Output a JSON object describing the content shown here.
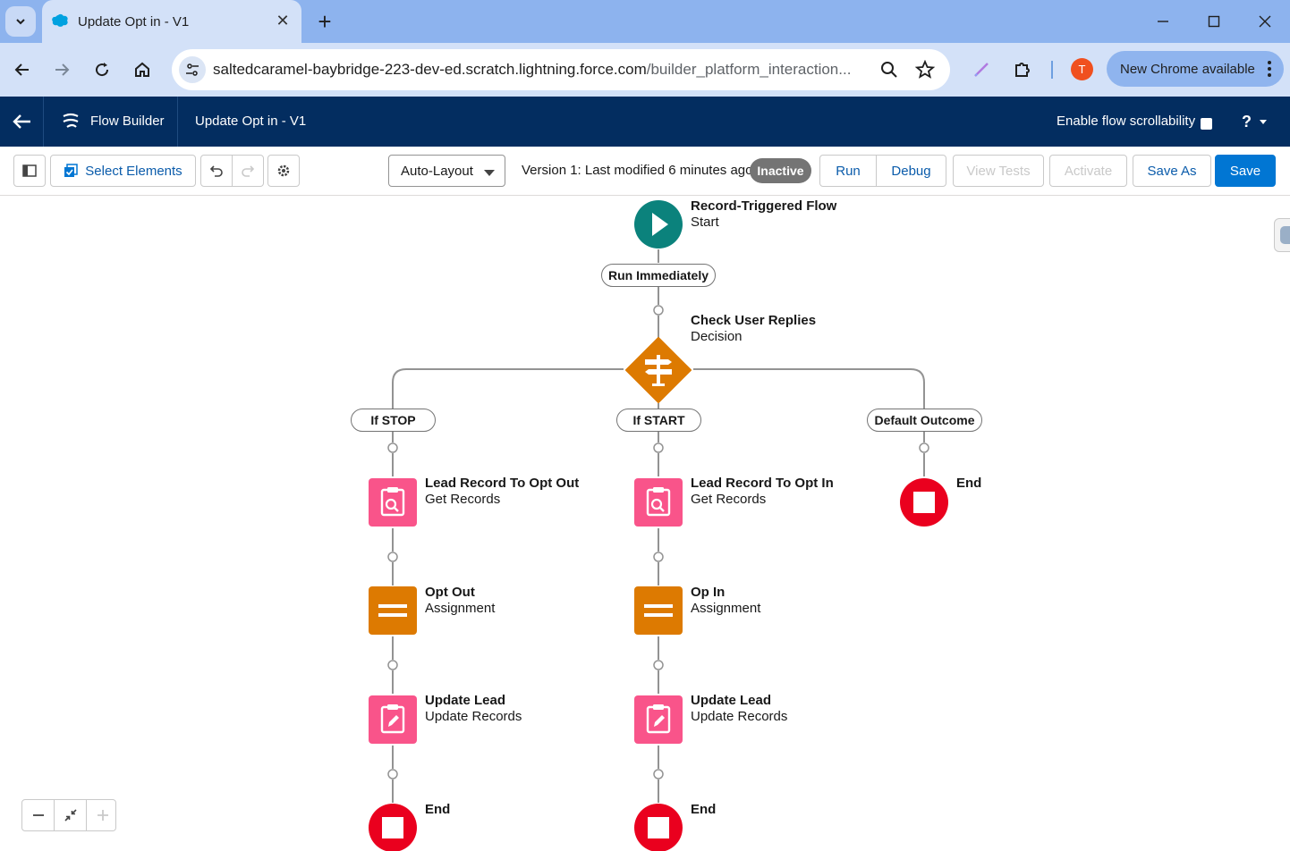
{
  "browser": {
    "tab_title": "Update Opt in - V1",
    "url_host": "saltedcaramel-baybridge-223-dev-ed.scratch.lightning.force.com",
    "url_path": "/builder_platform_interaction...",
    "avatar_letter": "T",
    "update_label": "New Chrome available"
  },
  "header": {
    "app_name": "Flow Builder",
    "flow_name": "Update Opt in - V1",
    "scroll_label": "Enable flow scrollability",
    "help_label": "?"
  },
  "toolbar": {
    "select_elements": "Select Elements",
    "layout_mode": "Auto-Layout",
    "version_text": "Version 1: Last modified 6 minutes ago",
    "status_badge": "Inactive",
    "run": "Run",
    "debug": "Debug",
    "view_tests": "View Tests",
    "activate": "Activate",
    "save_as": "Save As",
    "save": "Save"
  },
  "flow": {
    "start": {
      "title": "Record-Triggered Flow",
      "subtitle": "Start",
      "path_label": "Run Immediately"
    },
    "decision": {
      "title": "Check User Replies",
      "subtitle": "Decision"
    },
    "outcomes": [
      "If STOP",
      "If START",
      "Default Outcome"
    ],
    "branch_stop": {
      "get": {
        "title": "Lead Record To Opt Out",
        "subtitle": "Get Records"
      },
      "assign": {
        "title": "Opt Out",
        "subtitle": "Assignment"
      },
      "update": {
        "title": "Update Lead",
        "subtitle": "Update Records"
      },
      "end": "End"
    },
    "branch_start": {
      "get": {
        "title": "Lead Record To Opt In",
        "subtitle": "Get Records"
      },
      "assign": {
        "title": "Op In",
        "subtitle": "Assignment"
      },
      "update": {
        "title": "Update Lead",
        "subtitle": "Update Records"
      },
      "end": "End"
    },
    "branch_default": {
      "end": "End"
    }
  },
  "colors": {
    "start": "#0b827c",
    "decision": "#dd7a01",
    "records": "#f9548a",
    "assignment": "#dd7a01",
    "end": "#ea001e",
    "brand": "#0176d3",
    "header": "#032d60"
  }
}
